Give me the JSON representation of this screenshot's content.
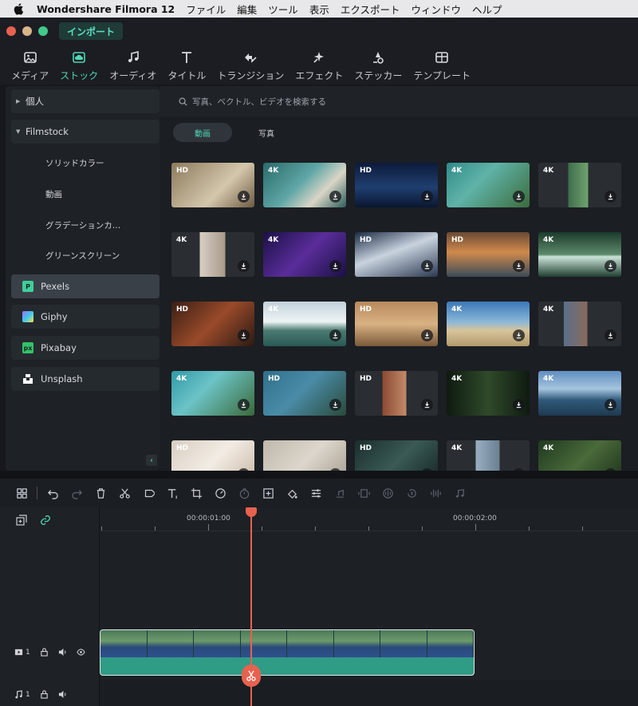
{
  "menubar": {
    "app": "Wondershare Filmora 12",
    "items": [
      "ファイル",
      "編集",
      "ツール",
      "表示",
      "エクスポート",
      "ウィンドウ",
      "ヘルプ"
    ]
  },
  "titlebar": {
    "import_label": "インポート"
  },
  "tabs": [
    {
      "label": "メディア",
      "icon": "media-icon"
    },
    {
      "label": "ストック",
      "icon": "stock-cloud-icon",
      "active": true
    },
    {
      "label": "オーディオ",
      "icon": "music-note-icon"
    },
    {
      "label": "タイトル",
      "icon": "title-text-icon"
    },
    {
      "label": "トランジション",
      "icon": "transition-icon"
    },
    {
      "label": "エフェクト",
      "icon": "effect-sparkle-icon"
    },
    {
      "label": "ステッカー",
      "icon": "sticker-icon"
    },
    {
      "label": "テンプレート",
      "icon": "template-icon"
    }
  ],
  "sidebar": {
    "personal": "個人",
    "filmstock": "Filmstock",
    "filmstock_items": [
      "ソリッドカラー",
      "動画",
      "グラデーションカ…",
      "グリーンスクリーン"
    ],
    "sources": [
      {
        "label": "Pexels",
        "color": "#3fcf9a",
        "active": true
      },
      {
        "label": "Giphy",
        "color": "#a46bf5"
      },
      {
        "label": "Pixabay",
        "color": "#34c26a"
      },
      {
        "label": "Unsplash",
        "color": "#ffffff"
      }
    ]
  },
  "search": {
    "placeholder": "写真、ベクトル、ビデオを検索する"
  },
  "subtabs": {
    "video": "動画",
    "photo": "写真"
  },
  "thumbnails": [
    [
      "HD",
      "4K",
      "HD",
      "4K",
      "4K"
    ],
    [
      "4K",
      "4K",
      "HD",
      "HD",
      "4K"
    ],
    [
      "HD",
      "4K",
      "HD",
      "4K",
      "4K"
    ],
    [
      "4K",
      "HD",
      "HD",
      "4K",
      "4K"
    ],
    [
      "HD",
      "",
      "HD",
      "4K",
      "4K"
    ]
  ],
  "timeline": {
    "time_labels": [
      "00:00:01:00",
      "00:00:02:00"
    ],
    "video_track": "1",
    "audio_track": "1"
  },
  "colors": {
    "accent": "#4fd6b4",
    "playhead": "#e8614f",
    "clip": "#2f9c86"
  }
}
